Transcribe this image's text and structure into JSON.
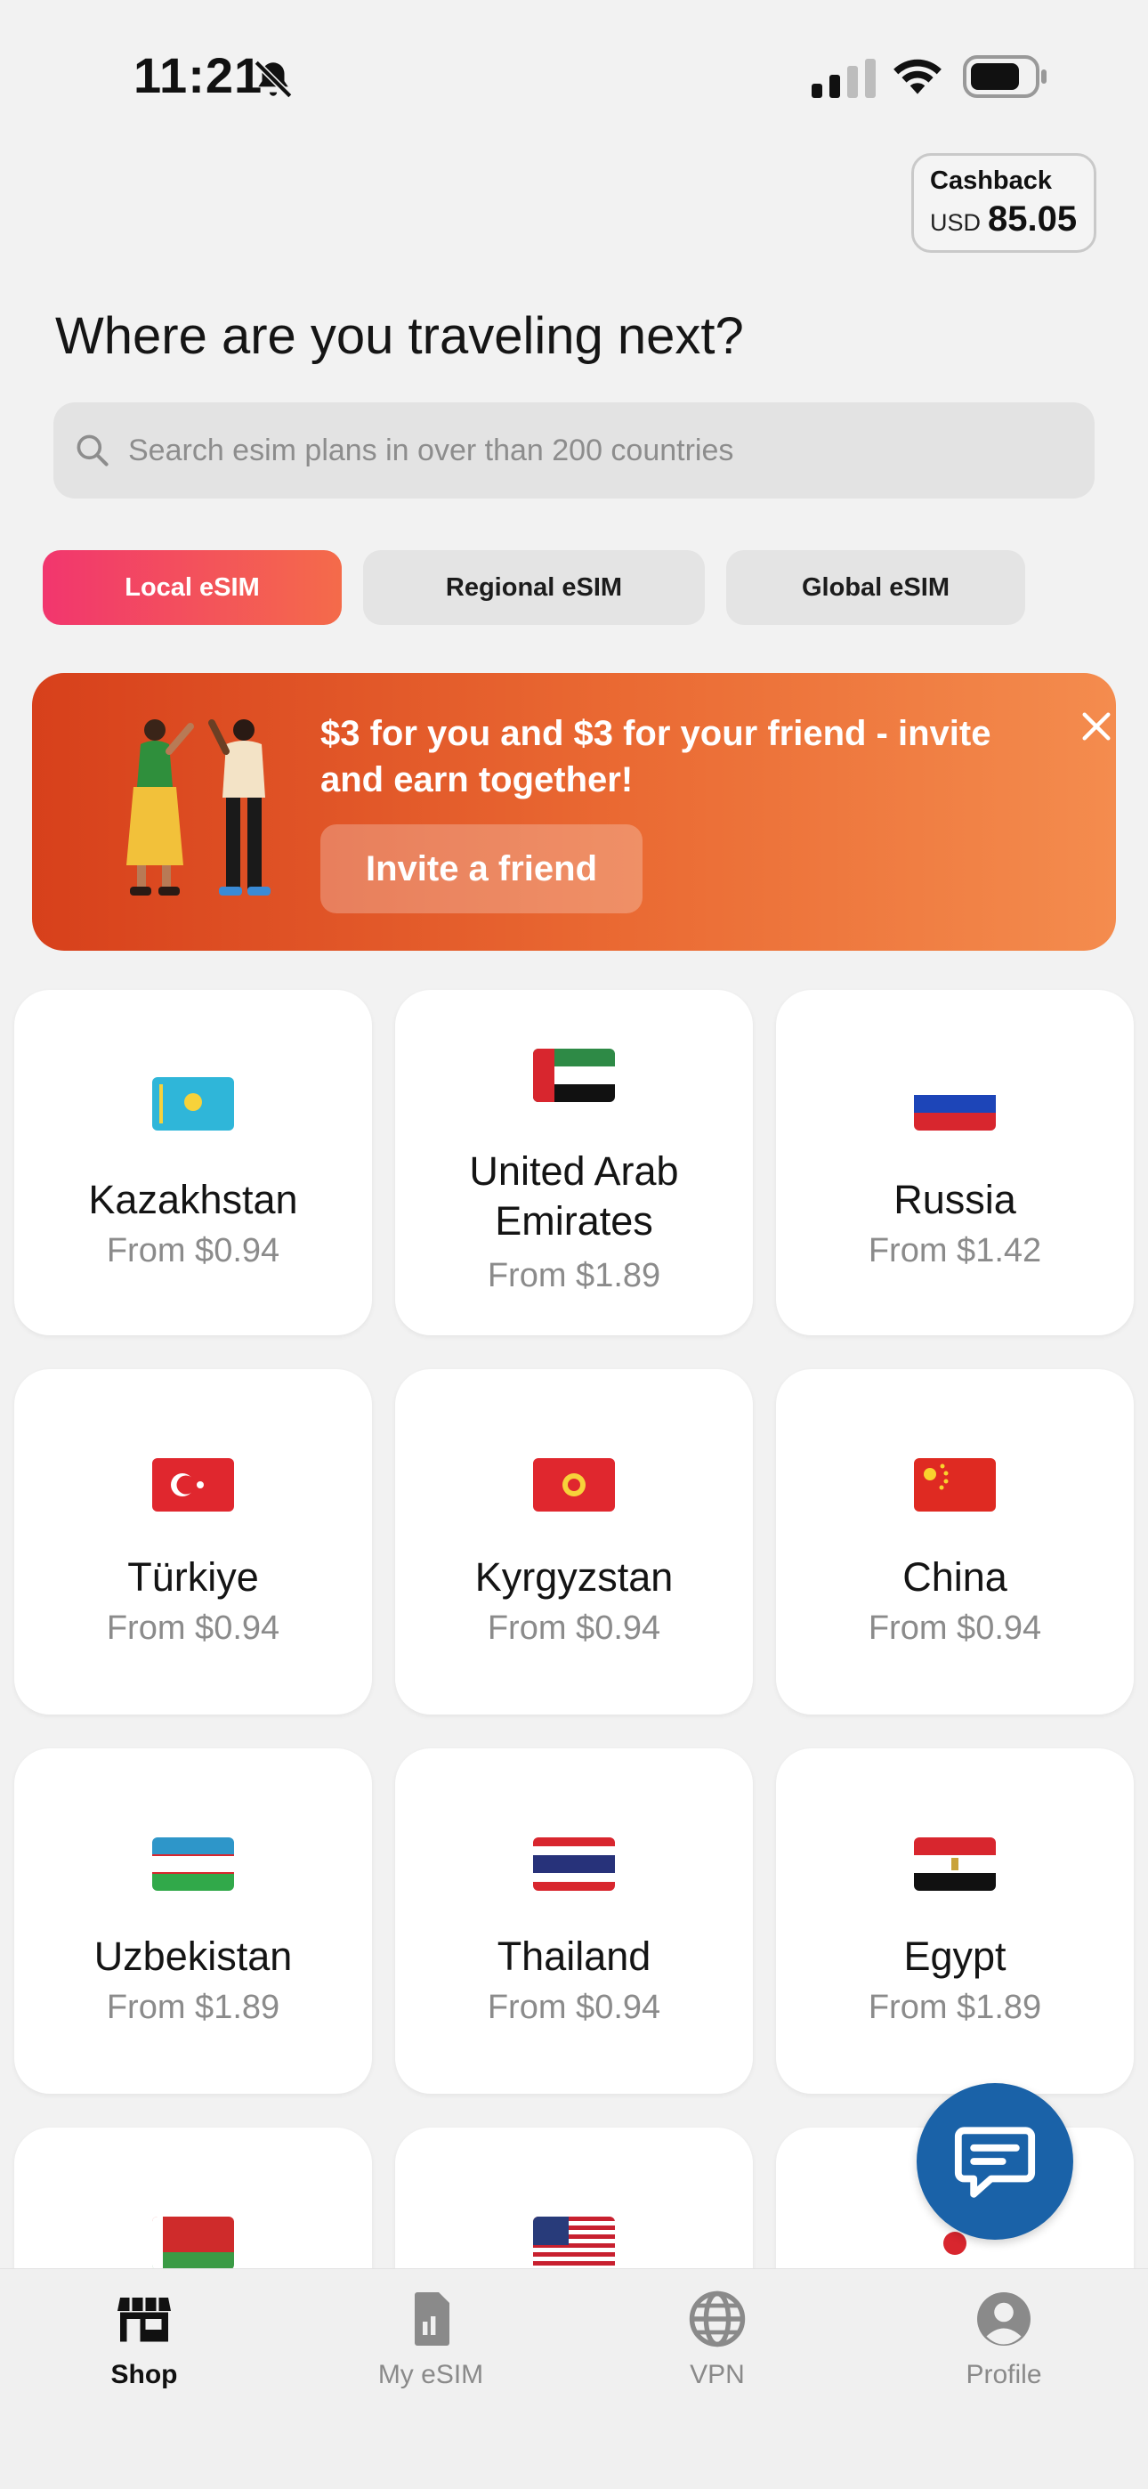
{
  "status": {
    "time": "11:21"
  },
  "cashback": {
    "title": "Cashback",
    "currency": "USD",
    "amount": "85.05"
  },
  "headline": "Where are you traveling next?",
  "search": {
    "placeholder": "Search esim plans in over than 200 countries"
  },
  "tabs": [
    {
      "label": "Local eSIM",
      "selected": true
    },
    {
      "label": "Regional eSIM",
      "selected": false
    },
    {
      "label": "Global eSIM",
      "selected": false
    }
  ],
  "promo": {
    "text": "$3 for you and $3 for your friend - invite and earn together!",
    "button": "Invite a friend"
  },
  "countries": [
    {
      "name": "Kazakhstan",
      "price": "From $0.94",
      "flag": "kazakhstan-flag-icon"
    },
    {
      "name": "United Arab Emirates",
      "price": "From $1.89",
      "flag": "uae-flag-icon"
    },
    {
      "name": "Russia",
      "price": "From $1.42",
      "flag": "russia-flag-icon"
    },
    {
      "name": "Türkiye",
      "price": "From $0.94",
      "flag": "turkey-flag-icon"
    },
    {
      "name": "Kyrgyzstan",
      "price": "From $0.94",
      "flag": "kyrgyzstan-flag-icon"
    },
    {
      "name": "China",
      "price": "From $0.94",
      "flag": "china-flag-icon"
    },
    {
      "name": "Uzbekistan",
      "price": "From $1.89",
      "flag": "uzbekistan-flag-icon"
    },
    {
      "name": "Thailand",
      "price": "From $0.94",
      "flag": "thailand-flag-icon"
    },
    {
      "name": "Egypt",
      "price": "From $1.89",
      "flag": "egypt-flag-icon"
    },
    {
      "name": "",
      "price": "",
      "flag": "belarus-flag-icon"
    },
    {
      "name": "",
      "price": "",
      "flag": "usa-flag-icon"
    },
    {
      "name": "",
      "price": "",
      "flag": "japan-flag-icon"
    }
  ],
  "tabbar": [
    {
      "label": "Shop",
      "icon": "shop-icon",
      "active": true
    },
    {
      "label": "My eSIM",
      "icon": "sim-card-icon",
      "active": false
    },
    {
      "label": "VPN",
      "icon": "globe-icon",
      "active": false
    },
    {
      "label": "Profile",
      "icon": "profile-icon",
      "active": false
    }
  ],
  "colors": {
    "accent_start": "#f2366e",
    "accent_end": "#f46b4a",
    "fab": "#1a62a8",
    "promo": "#e0561f"
  }
}
